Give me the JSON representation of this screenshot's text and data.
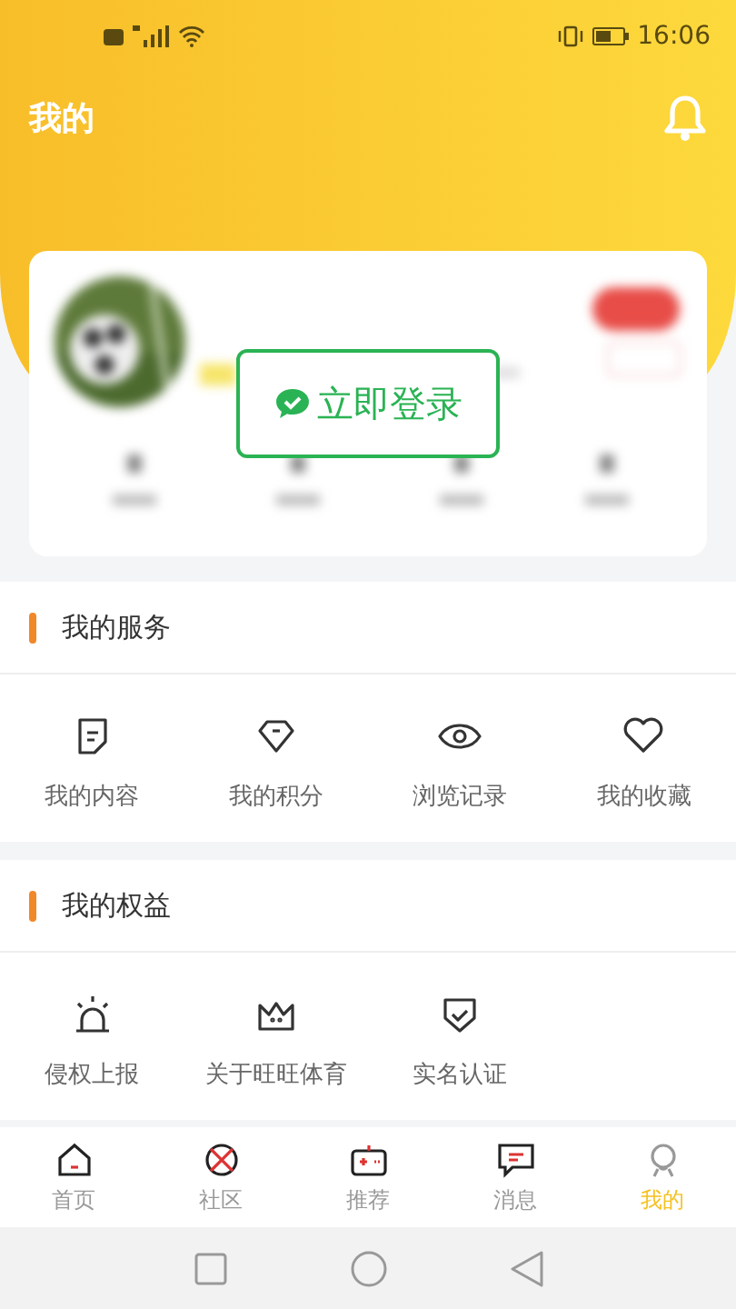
{
  "status_bar": {
    "time": "16:06"
  },
  "header": {
    "title": "我的"
  },
  "login_button": {
    "label": "立即登录"
  },
  "sections": [
    {
      "title": "我的服务",
      "items": [
        {
          "label": "我的内容",
          "kind": "note"
        },
        {
          "label": "我的积分",
          "kind": "gem"
        },
        {
          "label": "浏览记录",
          "kind": "eye"
        },
        {
          "label": "我的收藏",
          "kind": "heart"
        }
      ]
    },
    {
      "title": "我的权益",
      "items": [
        {
          "label": "侵权上报",
          "kind": "alarm"
        },
        {
          "label": "关于旺旺体育",
          "kind": "crown"
        },
        {
          "label": "实名认证",
          "kind": "shield"
        }
      ]
    }
  ],
  "tab_bar": [
    {
      "label": "首页",
      "kind": "home",
      "selected": false
    },
    {
      "label": "社区",
      "kind": "ball",
      "selected": false
    },
    {
      "label": "推荐",
      "kind": "game",
      "selected": false
    },
    {
      "label": "消息",
      "kind": "chat",
      "selected": false
    },
    {
      "label": "我的",
      "kind": "user",
      "selected": true
    }
  ]
}
